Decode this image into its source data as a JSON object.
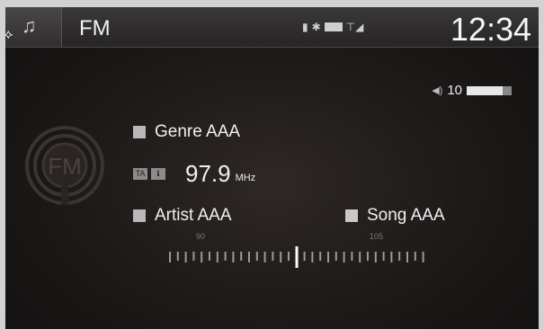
{
  "topbar": {
    "source": "FM",
    "clock": "12:34",
    "status_icons": [
      "phone-icon",
      "bluetooth-icon",
      "battery-icon",
      "signal-icon"
    ]
  },
  "volume": {
    "level": "10",
    "fraction": 0.8
  },
  "logo": {
    "text": "FM"
  },
  "genre": {
    "label": "Genre AAA"
  },
  "frequency": {
    "value": "97.9",
    "unit": "MHz",
    "tags": [
      "TA",
      "ℹ"
    ]
  },
  "artist": {
    "label": "Artist AAA"
  },
  "song": {
    "label": "Song AAA"
  },
  "tuner": {
    "labels": [
      "90",
      "105"
    ],
    "current": 97.9,
    "min": 87.5,
    "max": 108
  },
  "colors": {
    "accent": "#f0f0f0",
    "background": "#1c1918"
  }
}
